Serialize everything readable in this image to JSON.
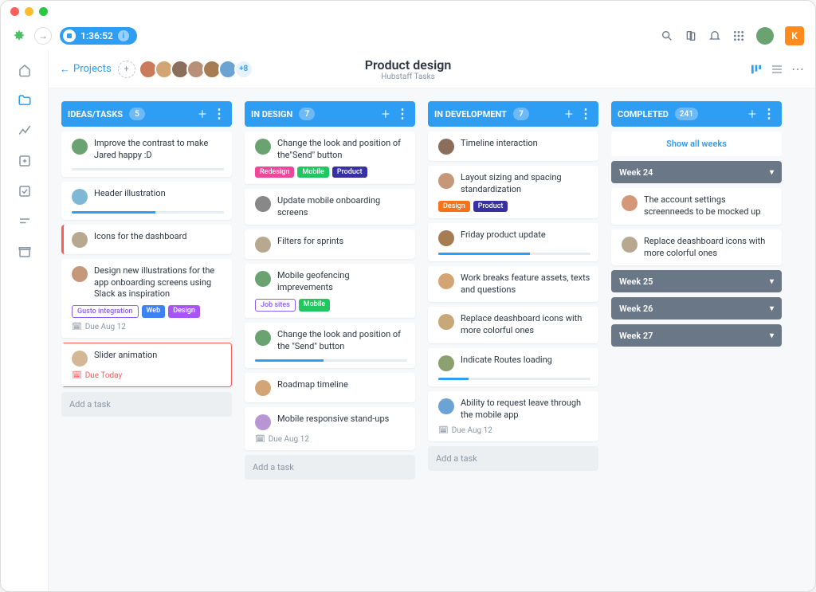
{
  "timer": {
    "time": "1:36:52"
  },
  "user_initial": "K",
  "header": {
    "back_label": "Projects",
    "more_count": "+8",
    "title": "Product design",
    "subtitle": "Hubstaff Tasks"
  },
  "avatars": [
    {
      "bg": "#c97b5a"
    },
    {
      "bg": "#d4a574"
    },
    {
      "bg": "#8b6f5c"
    },
    {
      "bg": "#b89078"
    },
    {
      "bg": "#a67c52"
    },
    {
      "bg": "#6ba3d4"
    }
  ],
  "columns": [
    {
      "title": "IDEAS/TASKS",
      "count": "5",
      "cards": [
        {
          "avatar": "#6ba370",
          "text": "Improve the contrast to make Jared happy :D",
          "progress": 0
        },
        {
          "avatar": "#7fb8d4",
          "text": "Header illustration",
          "progress": 55
        },
        {
          "avatar": "#b8a890",
          "text": "Icons for the dashboard",
          "redbar": true
        },
        {
          "avatar": "#c49878",
          "text": "Design new illustrations for the app onboarding screens using Slack as inspiration",
          "tags": [
            {
              "text": "Gusto integration",
              "bg": "#fff",
              "color": "#8b5cf6",
              "outline": true
            },
            {
              "text": "Web",
              "bg": "#3b82f6"
            },
            {
              "text": "Design",
              "bg": "#a855f7"
            }
          ],
          "due": "Due Aug 12"
        },
        {
          "avatar": "#d4b896",
          "text": "Slider animation",
          "red_border": true,
          "due": "Due Today",
          "due_red": true
        }
      ],
      "add_task": "Add a task"
    },
    {
      "title": "IN DESIGN",
      "count": "7",
      "cards": [
        {
          "avatar": "#6ba370",
          "text": "Change the look and position of the\"Send\" button",
          "tags": [
            {
              "text": "Redesign",
              "bg": "#ec4899"
            },
            {
              "text": "Mobile",
              "bg": "#22c55e"
            },
            {
              "text": "Product",
              "bg": "#3730a3"
            }
          ]
        },
        {
          "avatar": "#888",
          "text": "Update mobile onboarding screens"
        },
        {
          "avatar": "#b8a890",
          "text": "Filters for sprints"
        },
        {
          "avatar": "#6ba370",
          "text": "Mobile geofencing imprevements",
          "tags": [
            {
              "text": "Job sites",
              "bg": "#fff",
              "color": "#8b5cf6",
              "outline": true
            },
            {
              "text": "Mobile",
              "bg": "#22c55e"
            }
          ]
        },
        {
          "avatar": "#6ba370",
          "text": "Change the look and position of the \"Send\" button",
          "progress": 45
        },
        {
          "avatar": "#d4a574",
          "text": "Roadmap timeline"
        },
        {
          "avatar": "#b896d4",
          "text": "Mobile responsive stand-ups",
          "due": "Due Aug 12"
        }
      ],
      "add_task": "Add a task"
    },
    {
      "title": "IN DEVELOPMENT",
      "count": "7",
      "cards": [
        {
          "avatar": "#8b6f5c",
          "text": "Timeline interaction"
        },
        {
          "avatar": "#c49878",
          "text": "Layout sizing and spacing standardization",
          "tags": [
            {
              "text": "Design",
              "bg": "#f97316"
            },
            {
              "text": "Product",
              "bg": "#3730a3"
            }
          ]
        },
        {
          "avatar": "#a67c52",
          "text": "Friday product update",
          "progress": 60
        },
        {
          "avatar": "#d4a574",
          "text": "Work breaks feature assets, texts and questions"
        },
        {
          "avatar": "#c9a878",
          "text": "Replace deashboard icons with more colorful ones"
        },
        {
          "avatar": "#8b9f6f",
          "text": "Indicate Routes loading",
          "progress": 20
        },
        {
          "avatar": "#6ba3d4",
          "text": "Ability to request leave through the mobile app",
          "due": "Due Aug 12"
        }
      ],
      "add_task": "Add a task"
    },
    {
      "title": "COMPLETED",
      "count": "241",
      "show_all": "Show all weeks",
      "weeks": [
        {
          "label": "Week 24",
          "expanded": true,
          "cards": [
            {
              "avatar": "#d49878",
              "text": "The account settings screenneeds to be mocked up"
            },
            {
              "avatar": "#b8a890",
              "text": "Replace deashboard icons with more colorful ones"
            }
          ]
        },
        {
          "label": "Week 25"
        },
        {
          "label": "Week 26"
        },
        {
          "label": "Week 27"
        }
      ]
    }
  ]
}
